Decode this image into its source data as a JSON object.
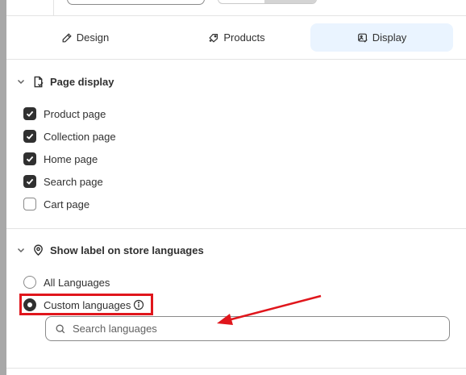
{
  "tabs": [
    {
      "label": "Design",
      "icon": "pencil-icon",
      "active": false
    },
    {
      "label": "Products",
      "icon": "tag-plus-icon",
      "active": false
    },
    {
      "label": "Display",
      "icon": "image-check-icon",
      "active": true
    }
  ],
  "page_display": {
    "title": "Page display",
    "icon": "page-icon",
    "options": [
      {
        "label": "Product page",
        "checked": true
      },
      {
        "label": "Collection page",
        "checked": true
      },
      {
        "label": "Home page",
        "checked": true
      },
      {
        "label": "Search page",
        "checked": true
      },
      {
        "label": "Cart page",
        "checked": false
      }
    ]
  },
  "languages": {
    "title": "Show label on store languages",
    "icon": "location-pin-icon",
    "options": [
      {
        "label": "All Languages",
        "selected": false
      },
      {
        "label": "Custom languages",
        "selected": true
      }
    ],
    "search_placeholder": "Search languages",
    "search_value": ""
  },
  "annotation": {
    "highlight_color": "#e0161c",
    "arrow_color": "#e0161c"
  },
  "colors": {
    "active_tab_bg": "#eaf4ff",
    "checked_fill": "#303030"
  }
}
